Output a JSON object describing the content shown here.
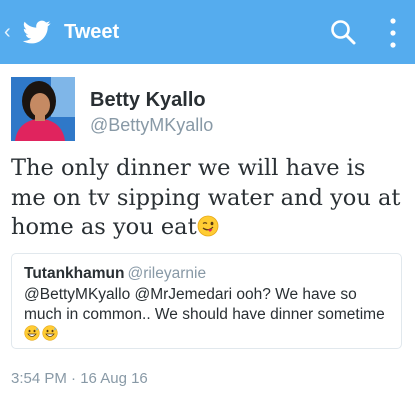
{
  "appbar": {
    "title": "Tweet",
    "back_glyph": "‹",
    "logo_icon": "twitter-bird-icon",
    "search_icon": "search-icon",
    "overflow_icon": "more-vertical-icon",
    "background_color": "#55acee"
  },
  "tweet": {
    "author_name": "Betty Kyallo",
    "author_handle": "@BettyMKyallo",
    "text": "The only dinner we will have is me on tv sipping water and you at home as you eat",
    "text_emoji": "winking-face-with-tongue-emoji",
    "timestamp": "3:54 PM · 16 Aug 16"
  },
  "quoted_tweet": {
    "author_name": "Tutankhamun",
    "author_handle": "@rileyarnie",
    "text": "@BettyMKyallo @MrJemedari ooh? We have so much in common.. We should have dinner sometime",
    "text_emoji": "grinning-face-with-sweat-emoji"
  }
}
